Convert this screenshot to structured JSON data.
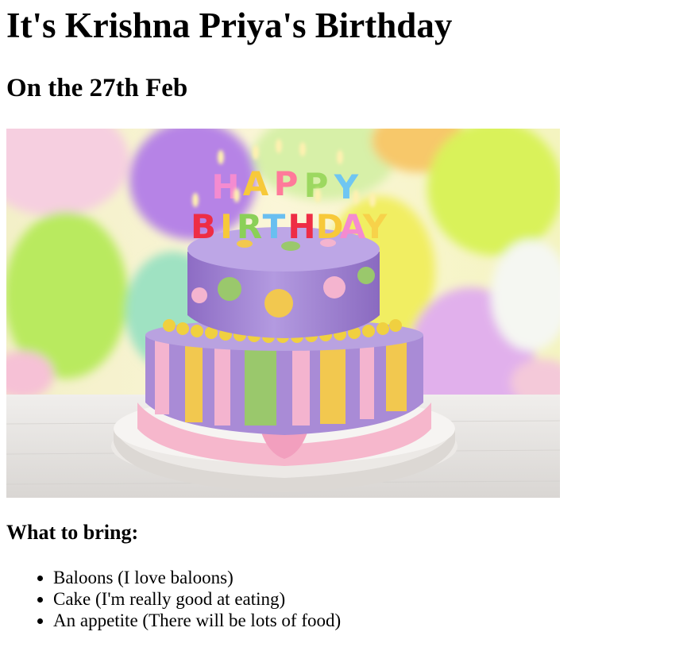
{
  "title": "It's Krishna Priya's Birthday",
  "subtitle": "On the 27th Feb",
  "image": {
    "candle_letters_top": [
      "H",
      "A",
      "P",
      "P",
      "Y"
    ],
    "candle_letters_bottom": [
      "B",
      "I",
      "R",
      "T",
      "H",
      "D",
      "A",
      "Y"
    ],
    "colors": {
      "cake_top": "#a98bd6",
      "cake_stripe_yellow": "#f2c84f",
      "cake_stripe_green": "#9ac86c",
      "cake_stripe_pink": "#f4b4cf",
      "ribbon": "#f6b7cc",
      "plate": "#f4f1ee"
    }
  },
  "bring_heading": "What to bring:",
  "bring_items": [
    "Baloons (I love baloons)",
    "Cake (I'm really good at eating)",
    "An appetite (There will be lots of food)"
  ]
}
